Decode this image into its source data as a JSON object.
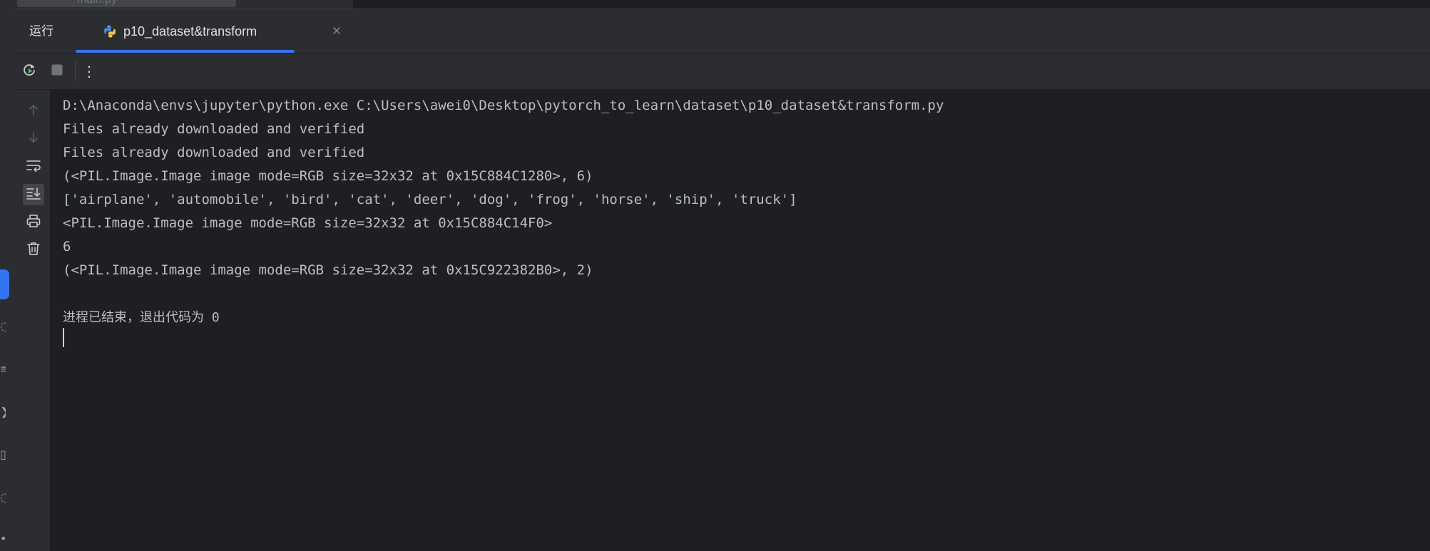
{
  "editor_tabs": {
    "partial_file_label": "main.py"
  },
  "tool_window": {
    "title": "运行",
    "run_tab": {
      "label": "p10_dataset&transform",
      "icon": "python-icon"
    },
    "close_glyph": "×"
  },
  "toolbar": {
    "rerun_icon": "rerun-icon",
    "stop_icon": "stop-icon",
    "more_glyph": "⋮"
  },
  "gutter": {
    "icons": [
      "arrow-up-icon",
      "arrow-down-icon",
      "soft-wrap-icon",
      "scroll-to-end-icon",
      "print-icon",
      "trash-icon"
    ],
    "selected": "scroll-to-end-icon"
  },
  "console": {
    "lines": [
      "D:\\Anaconda\\envs\\jupyter\\python.exe C:\\Users\\awei0\\Desktop\\pytorch_to_learn\\dataset\\p10_dataset&transform.py",
      "Files already downloaded and verified",
      "Files already downloaded and verified",
      "(<PIL.Image.Image image mode=RGB size=32x32 at 0x15C884C1280>, 6)",
      "['airplane', 'automobile', 'bird', 'cat', 'deer', 'dog', 'frog', 'horse', 'ship', 'truck']",
      "<PIL.Image.Image image mode=RGB size=32x32 at 0x15C884C14F0>",
      "6",
      "(<PIL.Image.Image image mode=RGB size=32x32 at 0x15C922382B0>, 2)",
      "",
      "进程已结束，退出代码为 0"
    ]
  },
  "colors": {
    "background": "#1e1f22",
    "panel": "#2b2d30",
    "accent": "#3574f0",
    "text": "#bcbec4"
  }
}
